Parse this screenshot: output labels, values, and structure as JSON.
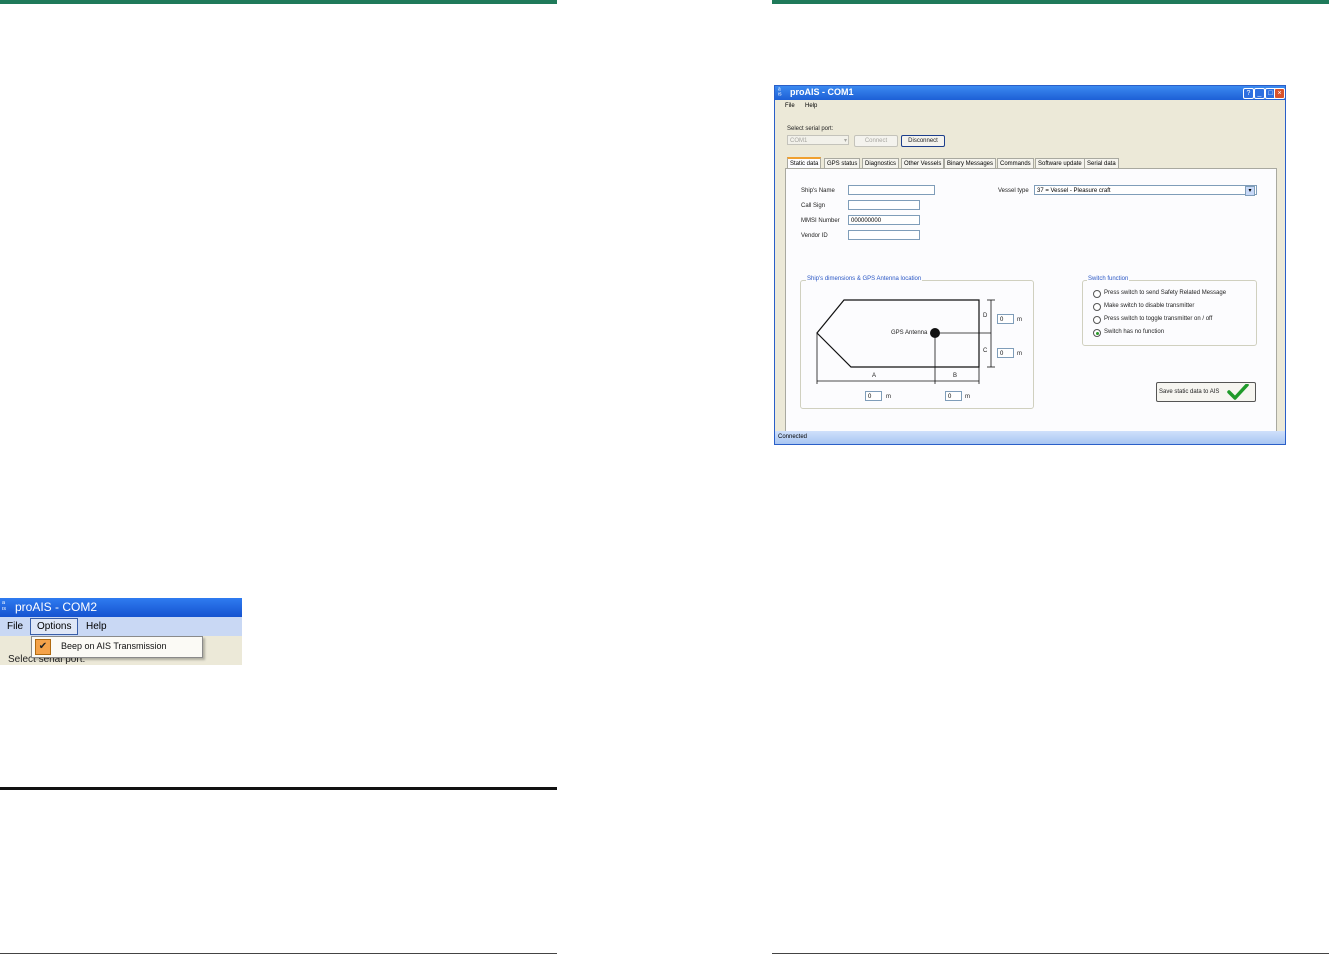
{
  "app_window": {
    "title": "proAIS - COM1",
    "menu": [
      "File",
      "Help"
    ],
    "serial_label": "Select serial port:",
    "port_value": "COM1",
    "connect_label": "Connect",
    "disconnect_label": "Disconnect",
    "tabs": [
      "Static data",
      "GPS status",
      "Diagnostics",
      "Other Vessels",
      "Binary Messages",
      "Commands",
      "Software update",
      "Serial data"
    ],
    "fields": {
      "ships_name_label": "Ship's Name",
      "ships_name_value": "",
      "call_sign_label": "Call Sign",
      "call_sign_value": "",
      "mmsi_label": "MMSI Number",
      "mmsi_value": "000000000",
      "vendor_label": "Vendor ID",
      "vendor_value": ""
    },
    "vessel_type_label": "Vessel type",
    "vessel_type_value": "37 = Vessel - Pleasure craft",
    "dimensions": {
      "group_title": "Ship's dimensions & GPS Antenna location",
      "antenna_label": "GPS Antenna",
      "a_label": "A",
      "b_label": "B",
      "c_label": "C",
      "d_label": "D",
      "a_value": "0",
      "b_value": "0",
      "c_value": "0",
      "d_value": "0",
      "unit": "m"
    },
    "switch_function": {
      "title": "Switch function",
      "options": [
        "Press switch to send Safety Related Message",
        "Make switch to disable transmitter",
        "Press switch to toggle transmitter on / off",
        "Switch has no function"
      ],
      "selected_index": 3
    },
    "save_label": "Save static data to AIS",
    "status": "Connected"
  },
  "menu_window": {
    "title": "proAIS - COM2",
    "menu": [
      "File",
      "Options",
      "Help"
    ],
    "dropdown_item": "Beep on AIS Transmission",
    "select_serial": "Select serial port:"
  },
  "colors": {
    "accent_rule": "#1f7a5a",
    "titlebar": "#1d5fd6",
    "check_green": "#1f9a2a"
  }
}
